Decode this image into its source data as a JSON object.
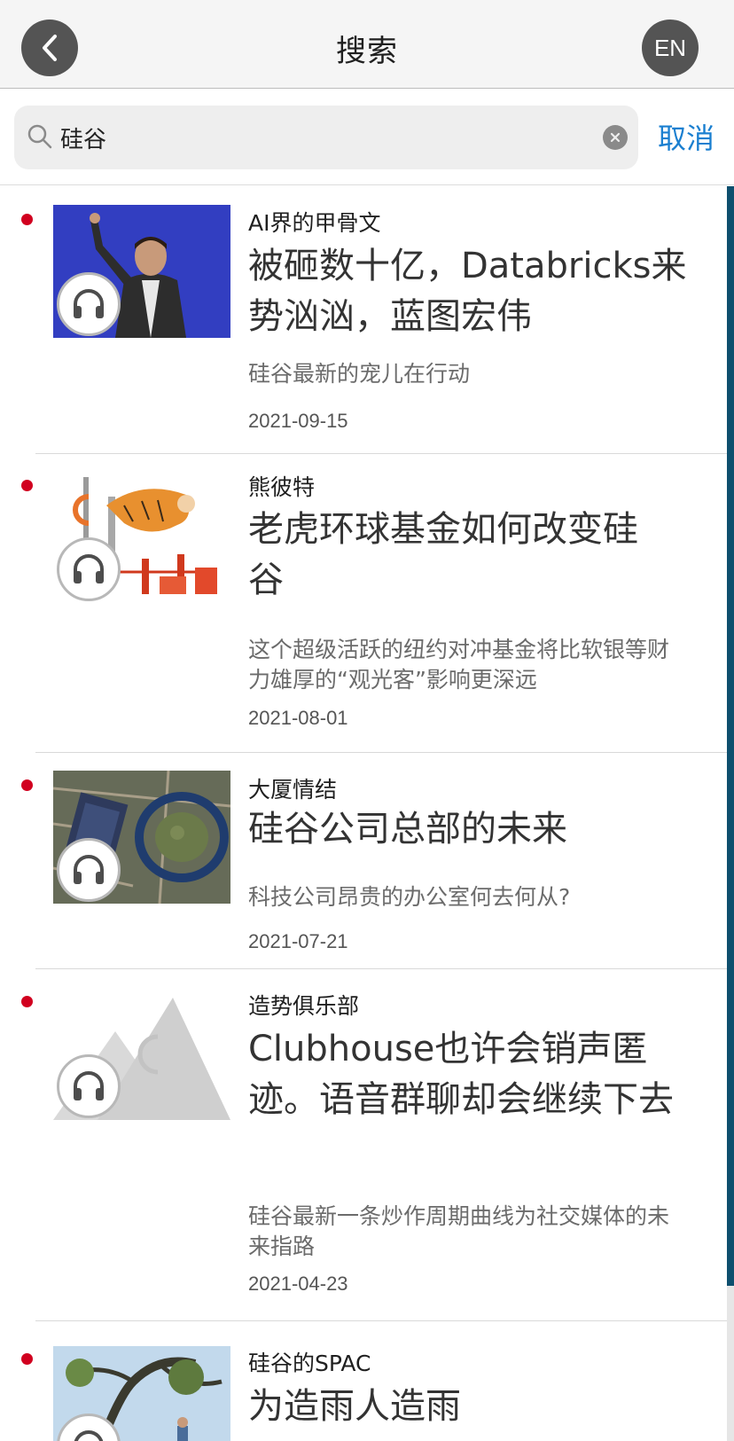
{
  "header": {
    "title": "搜索",
    "back_icon": "chevron-left-icon",
    "lang_label": "EN"
  },
  "search": {
    "value": "硅谷",
    "cancel_label": "取消",
    "search_icon": "search-icon",
    "clear_icon": "clear-icon"
  },
  "articles": [
    {
      "category": "AI界的甲骨文",
      "headline": "被砸数十亿，Databricks来势汹汹，蓝图宏伟",
      "subtitle": "硅谷最新的宠儿在行动",
      "date": "2021-09-15",
      "unread": true,
      "audio": true
    },
    {
      "category": "熊彼特",
      "headline": "老虎环球基金如何改变硅谷",
      "subtitle": "这个超级活跃的纽约对冲基金将比软银等财力雄厚的“观光客”影响更深远",
      "date": "2021-08-01",
      "unread": true,
      "audio": true
    },
    {
      "category": "大厦情结",
      "headline": "硅谷公司总部的未来",
      "subtitle": "科技公司昂贵的办公室何去何从?",
      "date": "2021-07-21",
      "unread": true,
      "audio": true
    },
    {
      "category": "造势俱乐部",
      "headline": "Clubhouse也许会销声匿迹。语音群聊却会继续下去",
      "subtitle": "硅谷最新一条炒作周期曲线为社交媒体的未来指路",
      "date": "2021-04-23",
      "unread": true,
      "audio": true
    },
    {
      "category": "硅谷的SPAC",
      "headline": "为造雨人造雨",
      "unread": true,
      "audio": true
    }
  ],
  "colors": {
    "accent": "#1a7fd0",
    "unread_dot": "#d1001f",
    "header_button": "#545454",
    "scrollbar": "#0e4f6e"
  }
}
